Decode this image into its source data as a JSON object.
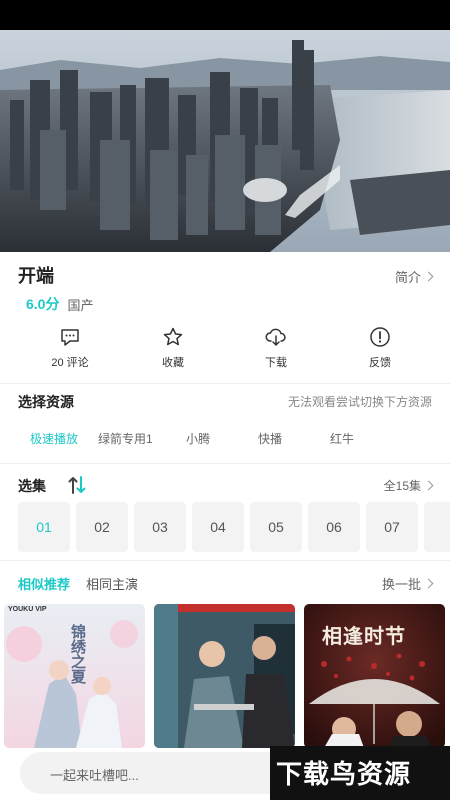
{
  "video": {
    "title": "开端",
    "intro_label": "简介",
    "score": "6.0分",
    "region": "国产"
  },
  "actions": [
    {
      "label": "20 评论",
      "icon": "comment-icon"
    },
    {
      "label": "收藏",
      "icon": "star-icon"
    },
    {
      "label": "下载",
      "icon": "cloud-download-icon"
    },
    {
      "label": "反馈",
      "icon": "alert-circle-icon"
    }
  ],
  "sources": {
    "title": "选择资源",
    "note": "无法观看尝试切换下方资源",
    "items": [
      "极速播放",
      "绿箭专用1",
      "小腾",
      "快播",
      "红牛"
    ],
    "selected_index": 0
  },
  "episodes": {
    "title": "选集",
    "all_label": "全15集",
    "items": [
      "01",
      "02",
      "03",
      "04",
      "05",
      "06",
      "07"
    ],
    "selected_index": 0
  },
  "recommend": {
    "tabs": [
      "相似推荐",
      "相同主演"
    ],
    "selected_index": 0,
    "refresh_label": "换一批",
    "posters": [
      {
        "brand": "YOUKU VIP",
        "title": "锦绣之夏"
      },
      {
        "brand": "",
        "title": ""
      },
      {
        "brand": "",
        "title": "相逢时节"
      }
    ]
  },
  "comment": {
    "placeholder": "一起来吐槽吧..."
  },
  "watermark": "下载鸟资源",
  "colors": {
    "accent": "#1fc8c8",
    "background": "#ffffff",
    "chip_bg": "#f3f3f3"
  }
}
